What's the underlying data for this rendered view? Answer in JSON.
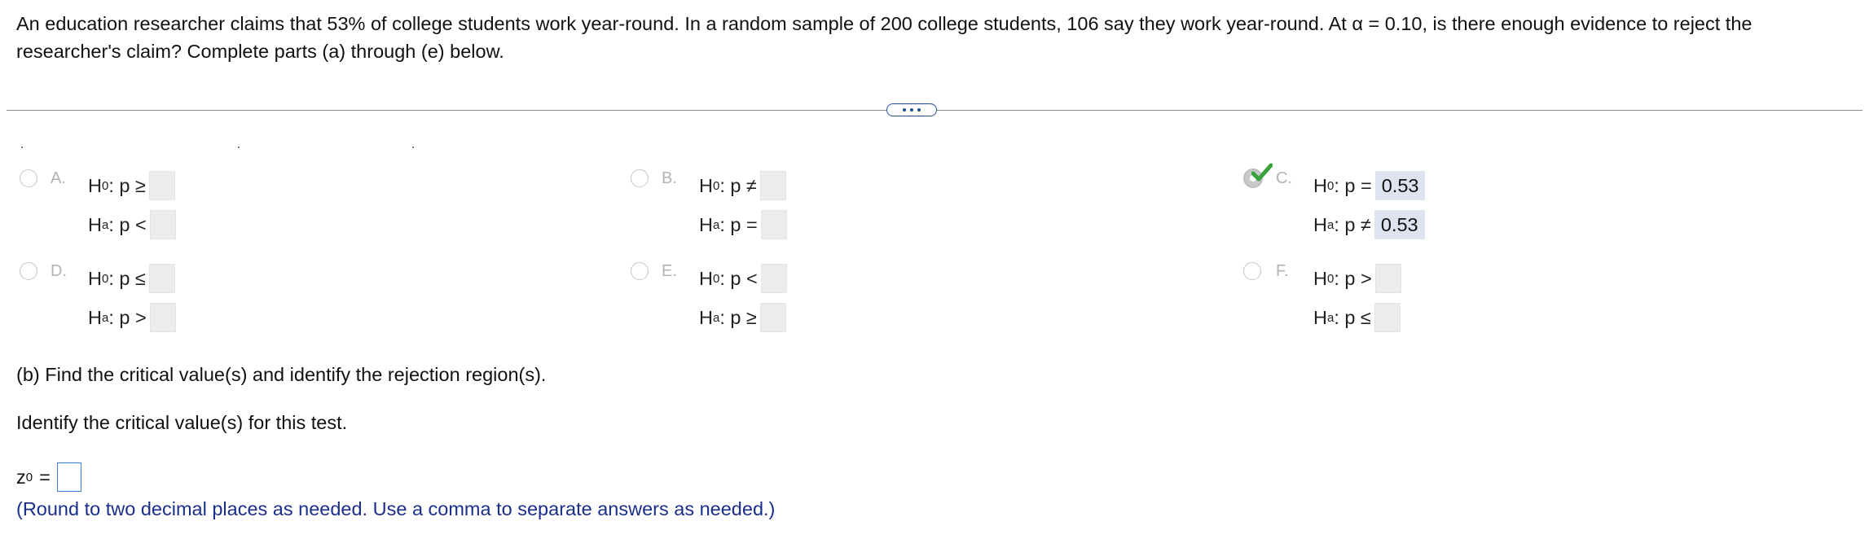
{
  "question": {
    "text": "An education researcher claims that 53% of college students work year-round. In a random sample of 200 college students, 106 say they work year-round. At α = 0.10, is there enough evidence to reject the researcher's claim? Complete parts (a) through (e) below."
  },
  "more_button_label": "...",
  "options": {
    "A": {
      "letter": "A.",
      "h0_op": ": p ≥",
      "ha_op": ": p <",
      "h0_val": "",
      "ha_val": "",
      "selected": false
    },
    "B": {
      "letter": "B.",
      "h0_op": ": p ≠",
      "ha_op": ": p =",
      "h0_val": "",
      "ha_val": "",
      "selected": false
    },
    "C": {
      "letter": "C.",
      "h0_op": ": p =",
      "ha_op": ": p ≠",
      "h0_val": "0.53",
      "ha_val": "0.53",
      "selected": true
    },
    "D": {
      "letter": "D.",
      "h0_op": ": p ≤",
      "ha_op": ": p >",
      "h0_val": "",
      "ha_val": "",
      "selected": false
    },
    "E": {
      "letter": "E.",
      "h0_op": ": p <",
      "ha_op": ": p ≥",
      "h0_val": "",
      "ha_val": "",
      "selected": false
    },
    "F": {
      "letter": "F.",
      "h0_op": ": p >",
      "ha_op": ": p ≤",
      "h0_val": "",
      "ha_val": "",
      "selected": false
    }
  },
  "hyp": {
    "H": "H",
    "null_sub": "0",
    "alt_sub": "a"
  },
  "part_b": {
    "heading": "(b) Find the critical value(s) and identify the rejection region(s).",
    "instruction": "Identify the critical value(s) for this test.",
    "z_label": "z",
    "z_sub": "0",
    "z_equals": "=",
    "z_value": "",
    "hint": "(Round to two decimal places as needed. Use a comma to separate answers as needed.)"
  },
  "colors": {
    "accent": "#1f4f95",
    "check": "#3aa23a",
    "hint": "#1a2f8c",
    "answer_bg": "#dde4f0"
  }
}
